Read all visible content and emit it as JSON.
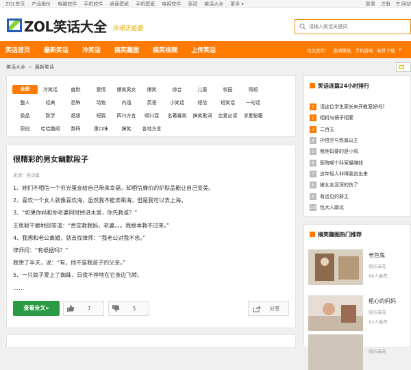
{
  "topbar": {
    "links": [
      "ZOL首页",
      "产品报价",
      "电脑软件",
      "手机软件",
      "桌面壁纸",
      "手机壁纸",
      "电视软件",
      "驱动",
      "笑话大全",
      "更多 ▾"
    ],
    "login": "登录",
    "register": "注册",
    "sitenav": "网站"
  },
  "header": {
    "logo_text": "ZOL笑话大全",
    "slogan": "传递正能量",
    "search_placeholder": "请输入笑话关键词"
  },
  "nav": {
    "items": [
      "笑话首页",
      "最新笑话",
      "冷笑话",
      "搞笑趣图",
      "搞笑视频",
      "上传笑话"
    ],
    "hot_label": "相关推荐：",
    "hot_links": [
      "高清壁纸",
      "手机游戏",
      "软件下载",
      "P"
    ]
  },
  "breadcrumb": {
    "home": "笑话大全",
    "sep": ">",
    "current": "最新笑话"
  },
  "categories": [
    [
      "全部",
      "冷笑话",
      "幽默",
      "爱情",
      "爆笑男女",
      "爆笑",
      "综合",
      "儿童",
      "校园",
      "简短"
    ],
    [
      "整人",
      "经典",
      "恐怖",
      "动物",
      "内涵",
      "英语",
      "小笑话",
      "短信",
      "短笑话",
      "一句话"
    ],
    [
      "极品",
      "数学",
      "超级",
      "短篇",
      "四川方言",
      "顺口溜",
      "名著暴笑",
      "搞笑歌词",
      "恋爱必读",
      "求爱秘籍"
    ],
    [
      "原创",
      "哈哈趣闻",
      "数码",
      "重口味",
      "搞笑",
      "各地方言"
    ]
  ],
  "article": {
    "title": "很精彩的男女幽默段子",
    "source": "来源：笑话集",
    "lines": [
      "1、她们不相信一个穷光蛋会给自己带来幸福，却相信廉价的护肤品能让自己变美。",
      "2、喜欢一个女人就像喜欢海，虽然我不能去跳海，但是我可以去上海。",
      "3、“如果你妈和你老婆同时掉进水里，你先救谁？”",
      "王思聪干脆地回答道：“肯定救我妈，老婆。。。我根本救不过来。”",
      "4、我想和老公离婚，就去找律师：“我老公对我不忠。”",
      "律师问：“有根据吗？”",
      "我想了半天，说：“有，他不是我孩子的父亲。”",
      "5、一只蚊子爱上了蜘蛛，日夜不停地在它身边飞转。",
      "……"
    ],
    "more_label": "查看全文»",
    "like_count": "7",
    "dislike_count": "5",
    "share_label": "分享"
  },
  "ranking": {
    "title": "笑话连篇24小时排行",
    "items": [
      {
        "n": "1",
        "text": "请这位学生家长来开教室好吗？"
      },
      {
        "n": "2",
        "text": "相机与镜子相爱"
      },
      {
        "n": "3",
        "text": "二百五"
      },
      {
        "n": "4",
        "text": "孙悟空与铁扇公主"
      },
      {
        "n": "5",
        "text": "我他妈要的是小鸡"
      },
      {
        "n": "6",
        "text": "医院哪个科室最赚钱"
      },
      {
        "n": "7",
        "text": "这年轻人非得我说出来"
      },
      {
        "n": "8",
        "text": "被女友泥深的伤了"
      },
      {
        "n": "9",
        "text": "有远见的群主"
      },
      {
        "n": "10",
        "text": "包大人蹭坑"
      }
    ]
  },
  "recommend": {
    "title": "搞笑趣图热门推荐",
    "items": [
      {
        "name": "老色鬼",
        "author": "快乐麻花",
        "count": "98人推荐"
      },
      {
        "name": "粗心的妈妈",
        "author": "快乐麻花",
        "count": "92人推荐"
      },
      {
        "name": "",
        "author": "快乐麻花",
        "count": ""
      }
    ]
  },
  "colors": {
    "accent": "#ff7a00",
    "more_button": "#2a9a44",
    "brand_blue": "#1f61b8"
  }
}
